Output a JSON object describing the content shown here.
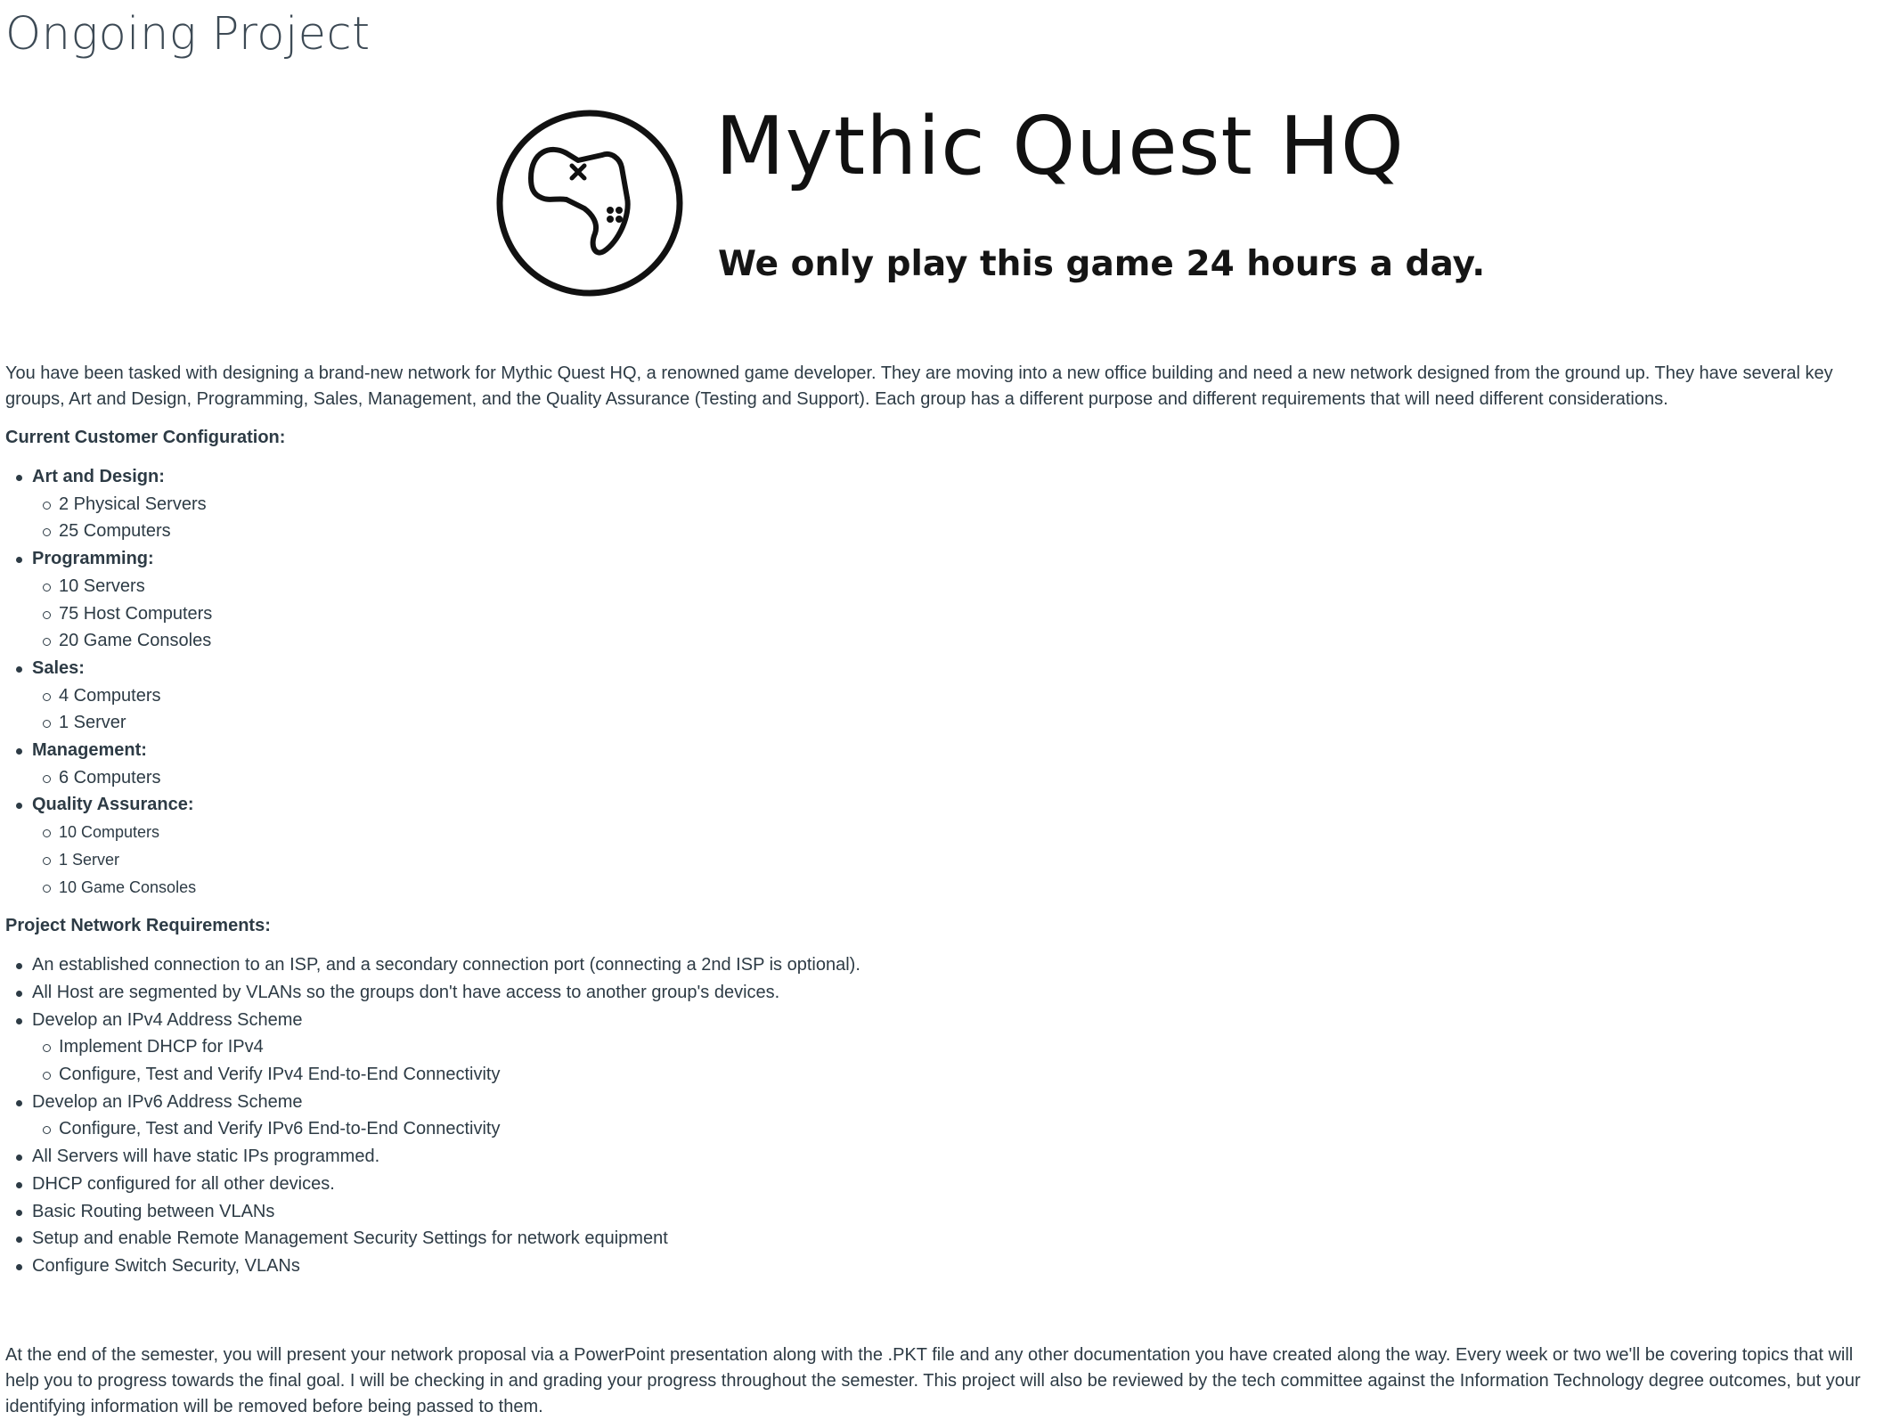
{
  "page": {
    "title": "Ongoing Project"
  },
  "banner": {
    "icon": "game-controller-icon",
    "name": "Mythic Quest HQ",
    "tagline": "We only play this game 24 hours a day."
  },
  "intro": "You have been tasked with designing a brand-new network for Mythic Quest HQ, a renowned game developer. They are moving into a new office building and need a new network designed from the ground up. They have several key groups, Art and Design, Programming, Sales, Management, and the Quality Assurance (Testing and Support). Each group has a different purpose and different requirements that will need different considerations.",
  "configuration": {
    "heading": "Current Customer Configuration:",
    "groups": [
      {
        "name": "Art and Design:",
        "items": [
          "2 Physical Servers",
          "25 Computers"
        ]
      },
      {
        "name": "Programming:",
        "items": [
          "10 Servers",
          "75 Host Computers",
          "20 Game Consoles"
        ]
      },
      {
        "name": "Sales:",
        "items": [
          "4 Computers",
          "1 Server"
        ]
      },
      {
        "name": "Management:",
        "items": [
          "6 Computers"
        ]
      },
      {
        "name": "Quality Assurance:",
        "items": [
          "10 Computers",
          "1 Server",
          "10 Game Consoles"
        ]
      }
    ]
  },
  "requirements": {
    "heading": "Project Network Requirements:",
    "items": [
      {
        "text": "An established connection to an ISP, and a secondary connection port (connecting a 2nd ISP is optional).",
        "sub": []
      },
      {
        "text": "All Host are segmented by VLANs so the groups don't have access to another group's devices.",
        "sub": []
      },
      {
        "text": "Develop an IPv4 Address Scheme",
        "sub": [
          "Implement DHCP for IPv4",
          "Configure, Test and Verify IPv4 End-to-End Connectivity"
        ]
      },
      {
        "text": "Develop an IPv6 Address Scheme",
        "sub": [
          "Configure, Test and Verify IPv6 End-to-End Connectivity"
        ]
      },
      {
        "text": "All Servers will have static IPs programmed.",
        "sub": []
      },
      {
        "text": "DHCP configured for all other devices.",
        "sub": []
      },
      {
        "text": "Basic Routing between VLANs",
        "sub": []
      },
      {
        "text": "Setup and enable Remote Management Security Settings for network equipment",
        "sub": []
      },
      {
        "text": "Configure Switch Security, VLANs",
        "sub": []
      }
    ]
  },
  "closing": "At the end of the semester, you will present your network proposal via a PowerPoint presentation along with the .PKT file and any other documentation you have created along the way.  Every week or two we'll be covering topics that will help you to progress towards the final goal.  I will be checking in and grading your progress throughout the semester.  This project will also be reviewed by the tech committee against the Information Technology degree outcomes, but your identifying information will be removed before being passed to them."
}
